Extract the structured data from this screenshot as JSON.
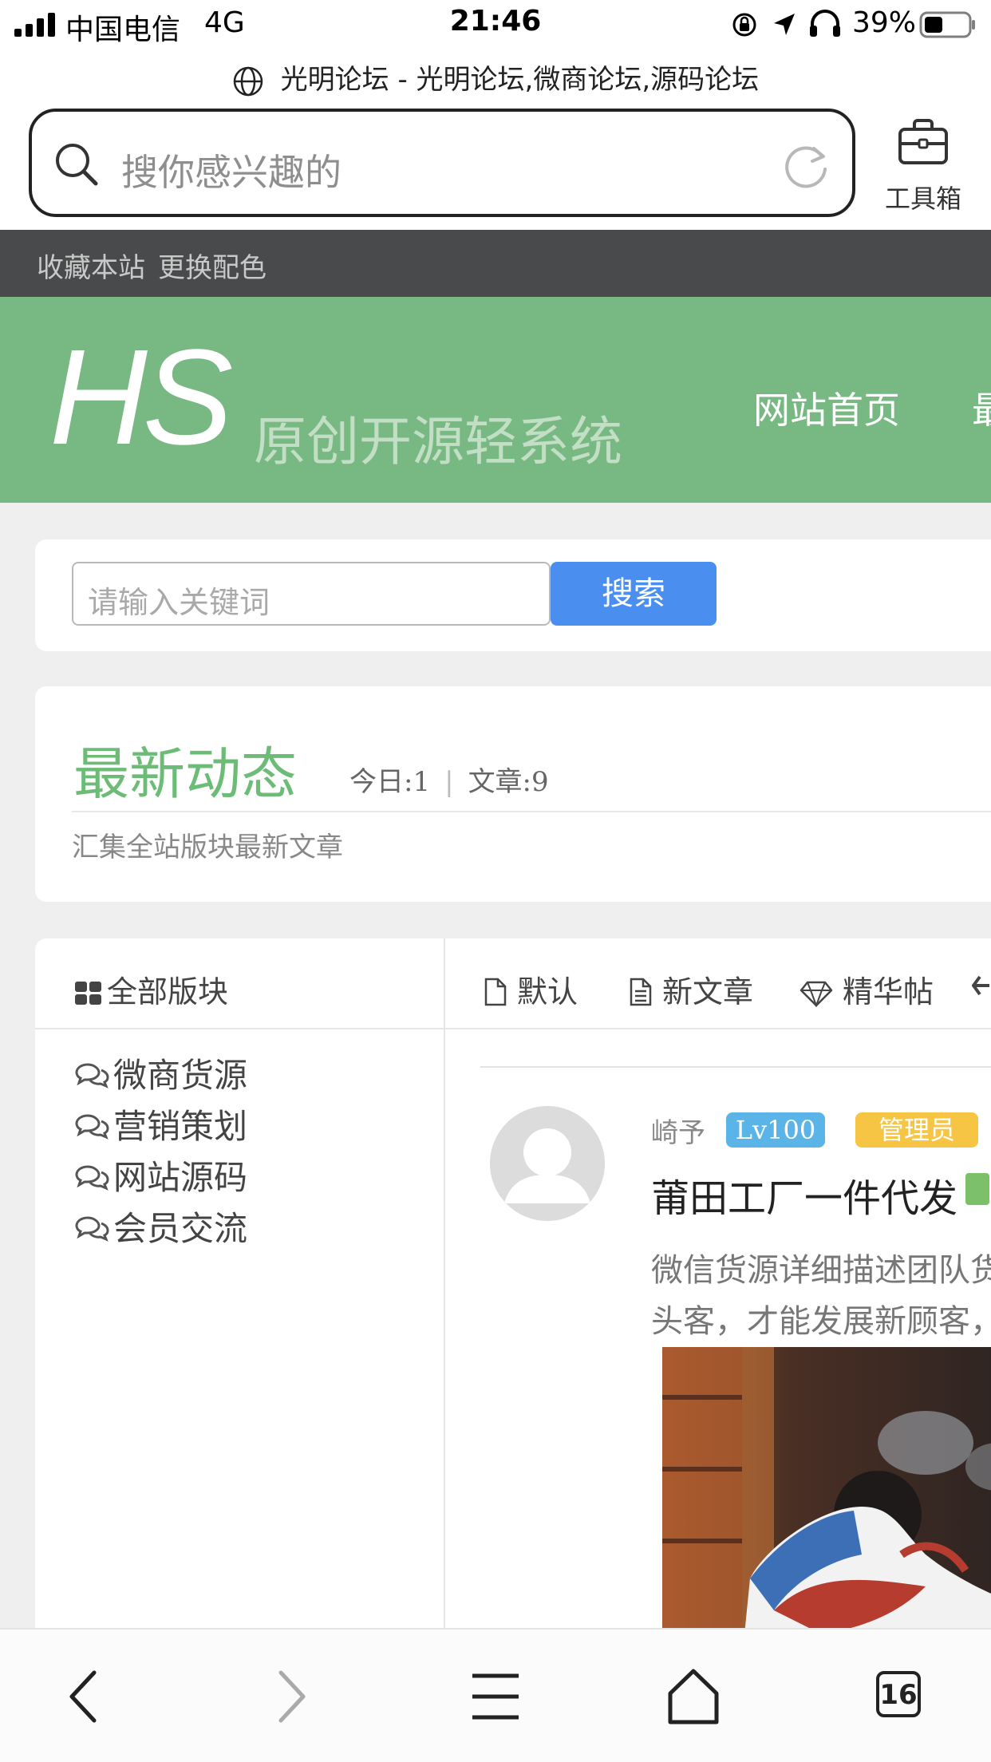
{
  "status_bar": {
    "carrier": "中国电信",
    "network": "4G",
    "time": "21:46",
    "battery_percent": "39%"
  },
  "browser": {
    "page_title": "光明论坛 - 光明论坛,微商论坛,源码论坛",
    "search_placeholder": "搜你感兴趣的",
    "toolbox_label": "工具箱",
    "tab_count": "16"
  },
  "top_links": {
    "bookmark": "收藏本站",
    "change_color": "更换配色"
  },
  "banner": {
    "logo_text": "HS",
    "logo_subtitle": "原创开源轻系统",
    "nav": [
      "网站首页",
      "最"
    ]
  },
  "search_box": {
    "placeholder": "请输入关键词",
    "button": "搜索"
  },
  "latest": {
    "title": "最新动态",
    "today": "今日:1",
    "articles": "文章:9",
    "description": "汇集全站版块最新文章"
  },
  "boards": {
    "header": "全部版块",
    "items": [
      "微商货源",
      "营销策划",
      "网站源码",
      "会员交流"
    ]
  },
  "sort_tabs": [
    "默认",
    "新文章",
    "精华帖"
  ],
  "post": {
    "author": "崎予",
    "level": "Lv100",
    "role": "管理员",
    "title": "莆田工厂一件代发",
    "excerpt_line1": "微信货源详细描述团队货",
    "excerpt_line2": "头客，才能发展新顾客，"
  },
  "colors": {
    "banner_green": "#78b882",
    "accent_green": "#6cbc78",
    "search_blue": "#4a8ef0",
    "level_badge": "#5bb4e8",
    "admin_badge": "#f6c544",
    "dark_strip": "#484a4b"
  }
}
